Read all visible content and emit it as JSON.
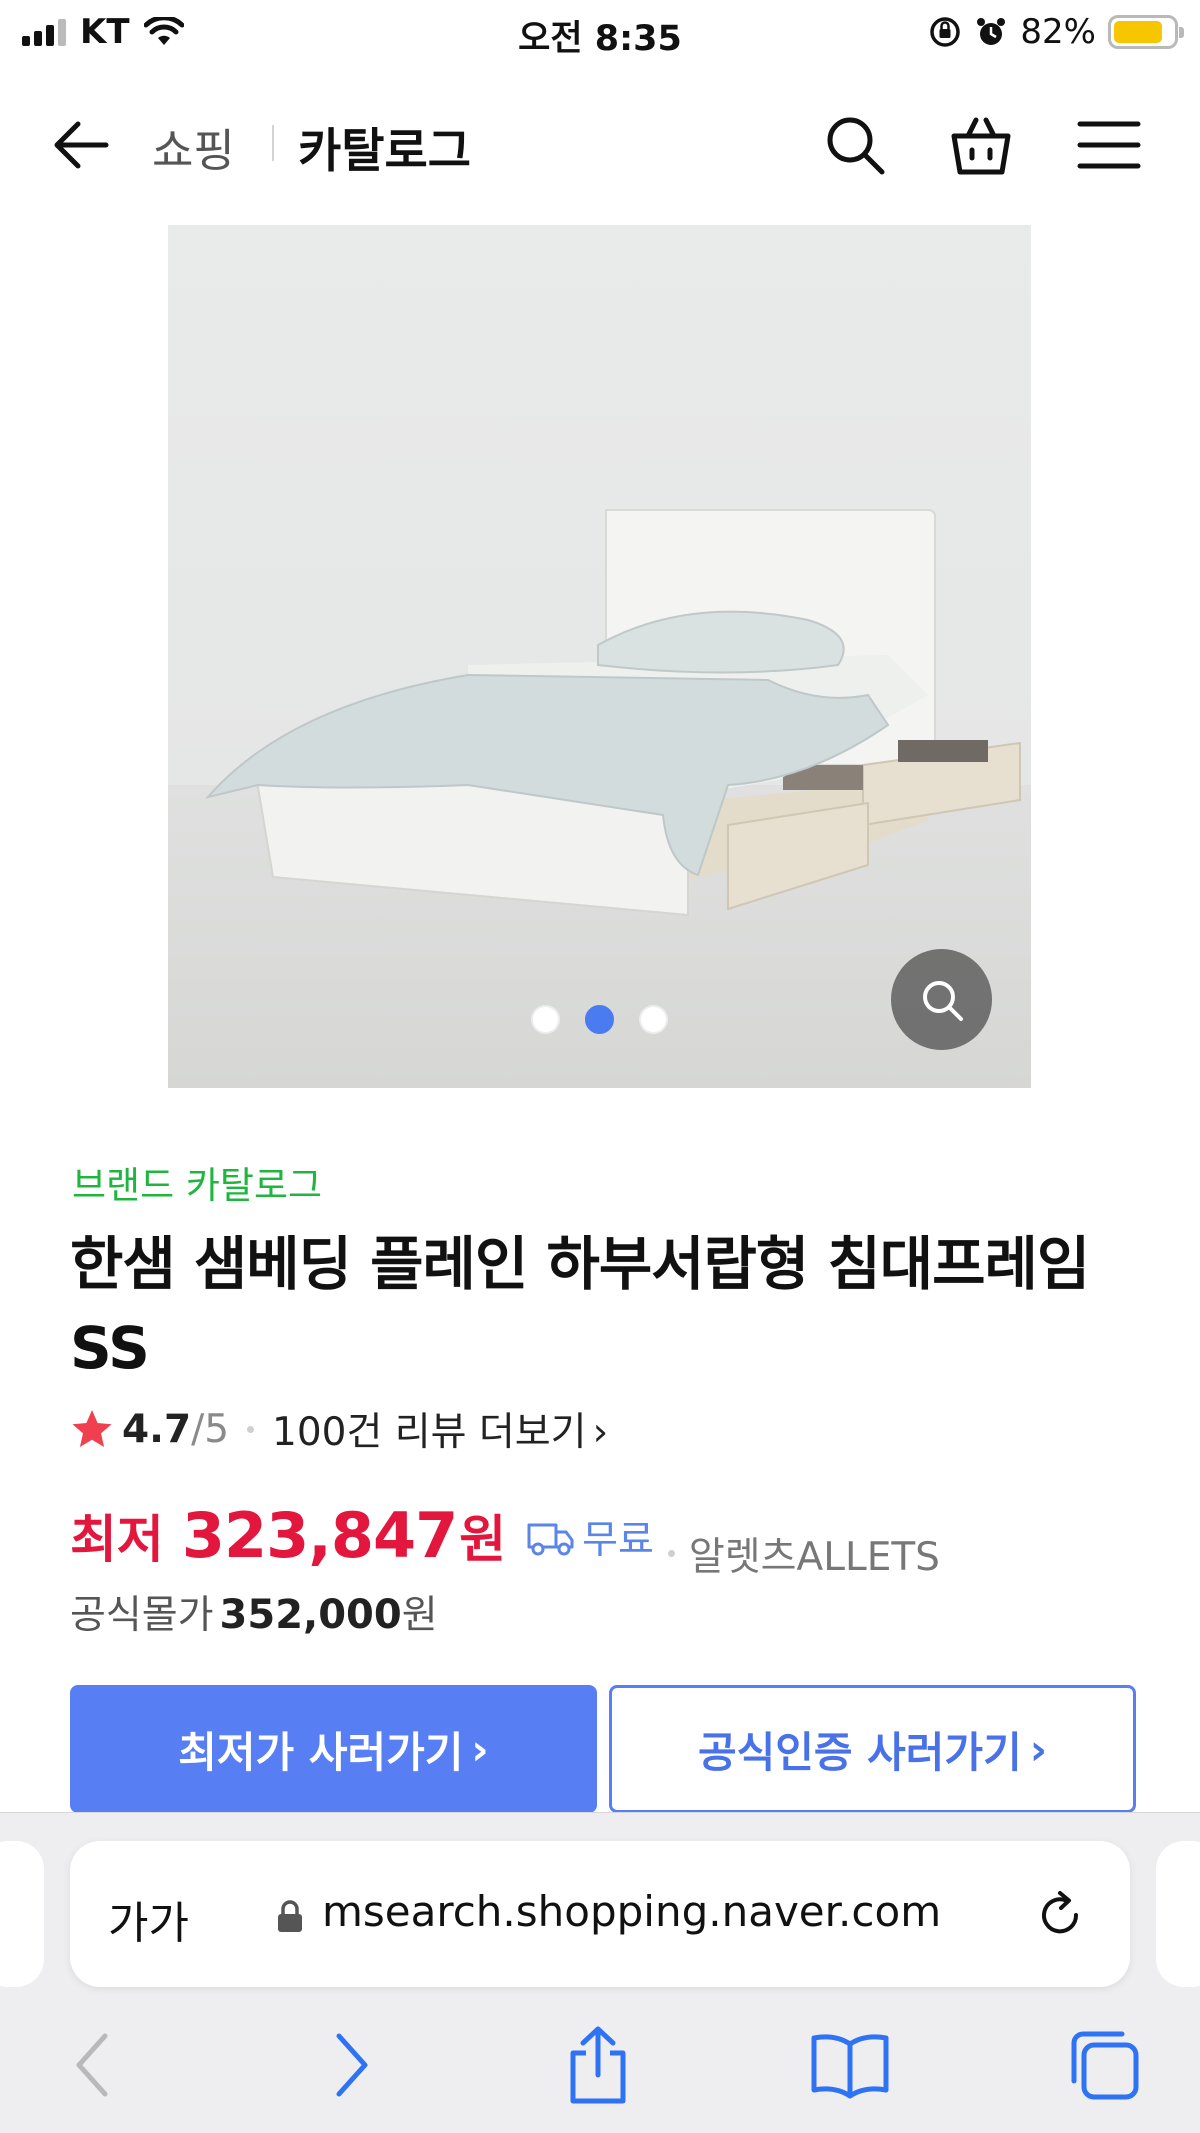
{
  "status_bar": {
    "carrier": "KT",
    "time": "오전 8:35",
    "battery_percent": "82%",
    "battery_level": 0.82,
    "battery_color": "#f7c600"
  },
  "header": {
    "back_icon": "arrow-left-icon",
    "breadcrumb_shop": "쇼핑",
    "breadcrumb_catalog": "카탈로그",
    "icons": [
      "search-icon",
      "shopping-bag-icon",
      "menu-icon"
    ]
  },
  "gallery": {
    "slide_count": 3,
    "active_slide": 2,
    "active_dot_color": "#4b7bf0",
    "zoom_icon": "magnifier-icon"
  },
  "product": {
    "brand_link": "브랜드 카탈로그",
    "title": "한샘 샘베딩 플레인 하부서랍형 침대프레임 SS",
    "rating_value": "4.7",
    "rating_max": "/5",
    "review_link": "100건 리뷰 더보기",
    "price_label": "최저",
    "price_value": "323,847",
    "price_unit": "원",
    "shipping": "무료",
    "seller": "알렛츠ALLETS",
    "official_label": "공식몰가",
    "official_value": "352,000",
    "official_unit": "원",
    "price_color": "#e3173d",
    "brand_color": "#1fb53f"
  },
  "cta": {
    "primary_label": "최저가 사러가기",
    "secondary_label": "공식인증 사러가기",
    "accent_color": "#587ef3"
  },
  "browser": {
    "text_size_button": "가가",
    "url": "msearch.shopping.naver.com",
    "toolbar_icons": [
      "back-icon",
      "forward-icon",
      "share-icon",
      "bookmarks-icon",
      "tabs-icon"
    ]
  }
}
